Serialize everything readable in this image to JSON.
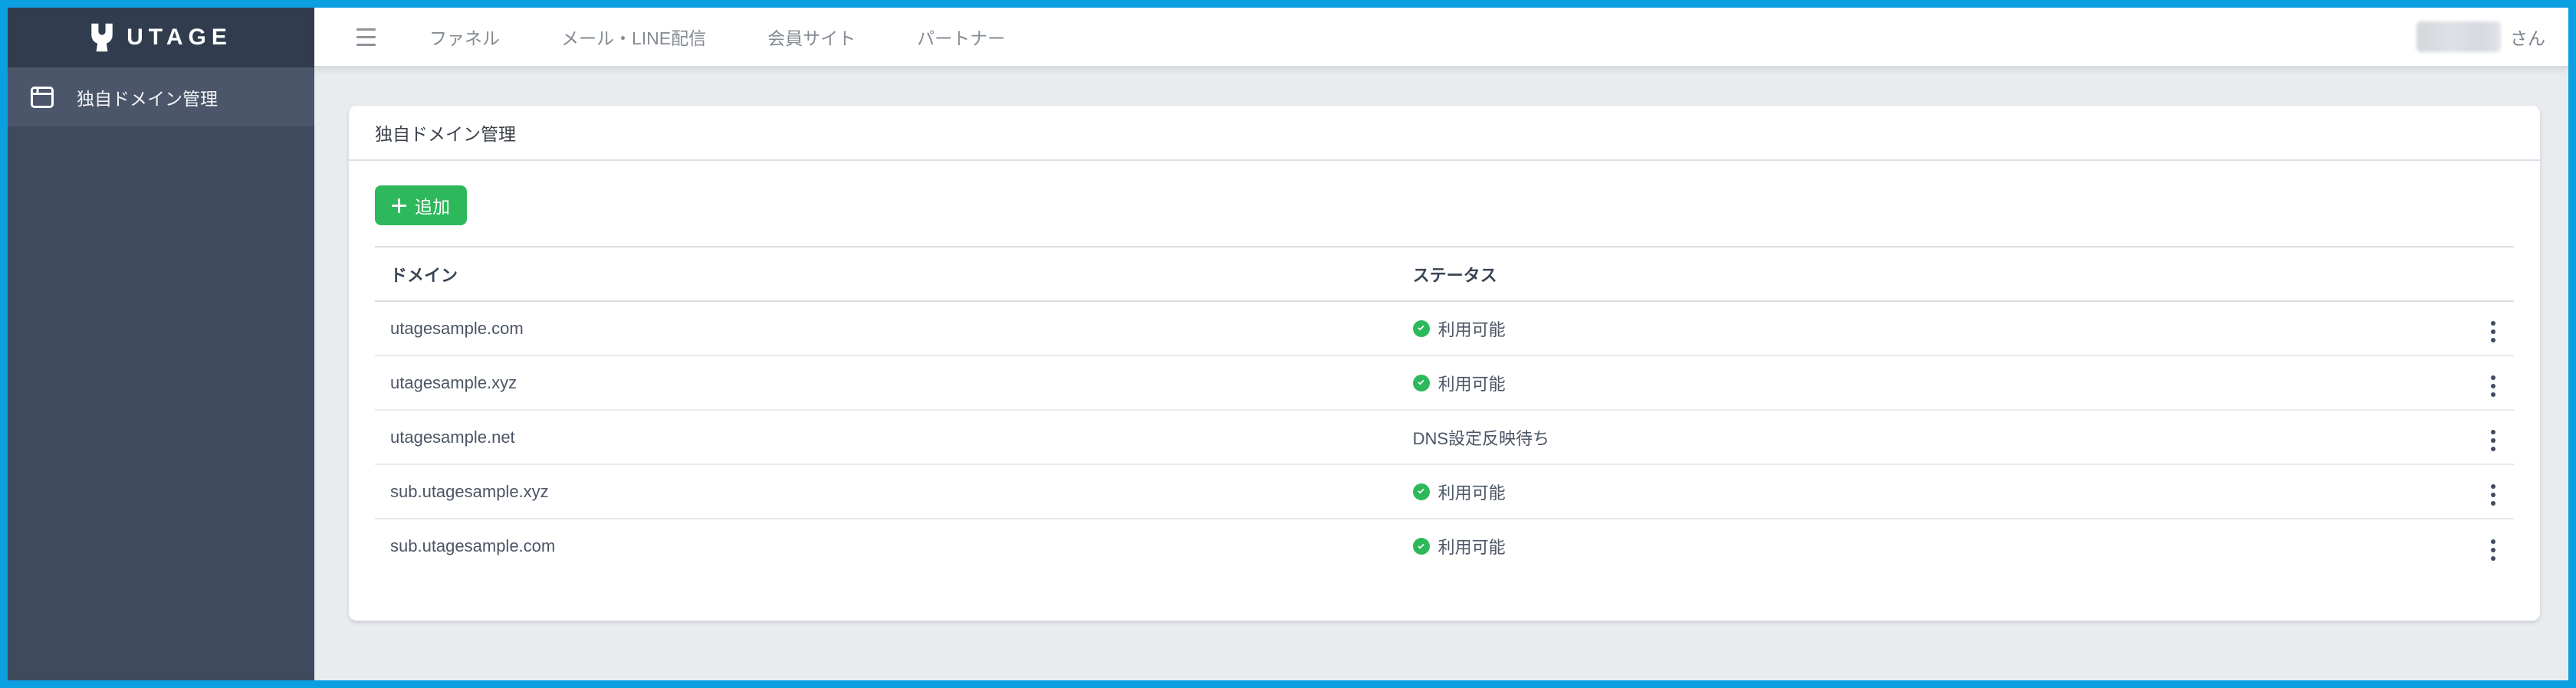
{
  "brand": {
    "name": "UTAGE",
    "logo_icon": "utage-u-icon"
  },
  "topnav": {
    "menu_icon": "hamburger-icon",
    "items": [
      {
        "label": "ファネル"
      },
      {
        "label": "メール・LINE配信"
      },
      {
        "label": "会員サイト"
      },
      {
        "label": "パートナー"
      }
    ],
    "user": {
      "name_redacted": true,
      "suffix": "さん"
    }
  },
  "sidebar": {
    "items": [
      {
        "label": "独自ドメイン管理",
        "icon": "window-icon",
        "active": true
      }
    ]
  },
  "main": {
    "card_title": "独自ドメイン管理",
    "add_button": {
      "icon": "plus-icon",
      "label": "追加"
    },
    "table": {
      "headers": {
        "domain": "ドメイン",
        "status": "ステータス",
        "actions": ""
      },
      "row_menu_icon": "kebab-vertical-icon",
      "status_ok_icon": "check-circle-icon",
      "rows": [
        {
          "domain": "utagesample.com",
          "status": "利用可能",
          "ok": true
        },
        {
          "domain": "utagesample.xyz",
          "status": "利用可能",
          "ok": true
        },
        {
          "domain": "utagesample.net",
          "status": "DNS設定反映待ち",
          "ok": false
        },
        {
          "domain": "sub.utagesample.xyz",
          "status": "利用可能",
          "ok": true
        },
        {
          "domain": "sub.utagesample.com",
          "status": "利用可能",
          "ok": true
        }
      ]
    }
  },
  "colors": {
    "frame_border": "#0ba0e2",
    "sidebar_header_bg": "#313d4f",
    "sidebar_bg": "#3e4a5e",
    "sidebar_active_bg": "#4c566a",
    "content_bg": "#e9ecef",
    "success_green": "#2eb85c",
    "text_dark": "#3c424a",
    "text_muted": "#848b92"
  }
}
